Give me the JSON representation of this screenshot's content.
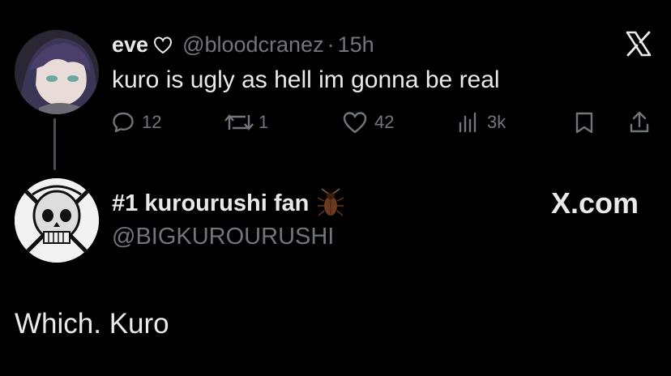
{
  "tweet": {
    "display_name": "eve",
    "name_emoji": "♡",
    "handle": "@bloodcranez",
    "separator": "·",
    "time": "15h",
    "text": "kuro is ugly as hell im gonna be real",
    "actions": {
      "replies": "12",
      "reposts": "1",
      "likes": "42",
      "views": "3k"
    }
  },
  "reply": {
    "display_name": "#1 kurourushi fan",
    "name_emoji": "cockroach",
    "handle": "@BIGKUROURUSHI",
    "source": "X.com",
    "text": "Which. Kuro"
  },
  "icons": {
    "x_logo": "x-logo-icon",
    "reply": "speech-bubble-icon",
    "repost": "repost-arrows-icon",
    "like": "heart-icon",
    "views": "bar-chart-icon",
    "bookmark": "bookmark-icon",
    "share": "share-upload-icon"
  },
  "colors": {
    "background": "#000000",
    "text": "#e7e9ea",
    "muted": "#71767b"
  }
}
